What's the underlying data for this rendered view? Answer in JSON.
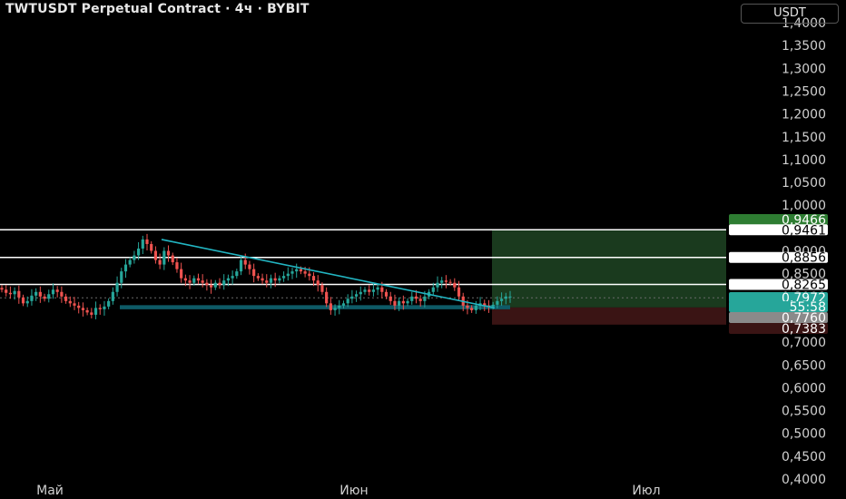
{
  "header": {
    "title": "TWTUSDT Perpetual Contract · 4ч · BYBIT",
    "currency": "USDT"
  },
  "colors": {
    "up": "#26a69a",
    "down": "#ef5350",
    "trendline": "#22b5c2",
    "support_zone": "#0e5a66",
    "profit_zone": "#1a3a1e",
    "stop_zone": "#3a1414",
    "current_price_badge": "#26a69a",
    "white_line": "#ffffff"
  },
  "chart_data": {
    "type": "candlestick",
    "symbol": "TWTUSDT Perpetual Contract",
    "interval": "4ч",
    "exchange": "BYBIT",
    "x_tick_labels": [
      "Май",
      "Июн",
      "Июл"
    ],
    "y_tick_labels": [
      "1,4000",
      "1,3500",
      "1,3000",
      "1,2500",
      "1,2000",
      "1,1500",
      "1,1000",
      "1,0500",
      "1,0000",
      "0,9500",
      "0,9000",
      "0,8500",
      "0,8000",
      "0,7500",
      "0,7000",
      "0,6500",
      "0,6000",
      "0,5500",
      "0,5000",
      "0,4500",
      "0,4000"
    ],
    "ylim": [
      0.4,
      1.4
    ],
    "horizontal_levels": [
      0.9461,
      0.8856,
      0.8265
    ],
    "price_labels": [
      {
        "text": "0,9466",
        "kind": "target"
      },
      {
        "text": "0,9461",
        "kind": "level"
      },
      {
        "text": "0,8856",
        "kind": "level"
      },
      {
        "text": "0,8265",
        "kind": "level"
      },
      {
        "text": "0,7972",
        "kind": "current"
      },
      {
        "text": "55:58",
        "kind": "countdown"
      },
      {
        "text": "0,7760",
        "kind": "entry"
      },
      {
        "text": "0,7383",
        "kind": "stop"
      }
    ],
    "current_price": 0.7972,
    "position": {
      "entry": 0.776,
      "target": 0.9466,
      "stop": 0.7383
    },
    "trendline": {
      "start_price": 0.925,
      "end_price": 0.775
    },
    "support_zone": {
      "low": 0.772,
      "high": 0.781
    },
    "closes": [
      0.815,
      0.808,
      0.805,
      0.812,
      0.798,
      0.785,
      0.79,
      0.802,
      0.81,
      0.8,
      0.795,
      0.805,
      0.815,
      0.81,
      0.8,
      0.79,
      0.785,
      0.78,
      0.775,
      0.77,
      0.765,
      0.76,
      0.775,
      0.772,
      0.778,
      0.79,
      0.81,
      0.83,
      0.855,
      0.87,
      0.88,
      0.89,
      0.905,
      0.925,
      0.915,
      0.9,
      0.88,
      0.87,
      0.9,
      0.89,
      0.875,
      0.86,
      0.84,
      0.835,
      0.83,
      0.84,
      0.835,
      0.83,
      0.825,
      0.82,
      0.83,
      0.825,
      0.835,
      0.84,
      0.845,
      0.855,
      0.88,
      0.87,
      0.86,
      0.845,
      0.84,
      0.835,
      0.83,
      0.84,
      0.835,
      0.84,
      0.845,
      0.85,
      0.855,
      0.86,
      0.855,
      0.85,
      0.845,
      0.835,
      0.825,
      0.81,
      0.785,
      0.77,
      0.775,
      0.78,
      0.785,
      0.795,
      0.8,
      0.805,
      0.81,
      0.815,
      0.81,
      0.815,
      0.82,
      0.81,
      0.8,
      0.79,
      0.78,
      0.79,
      0.785,
      0.79,
      0.8,
      0.795,
      0.79,
      0.8,
      0.81,
      0.82,
      0.83,
      0.835,
      0.832,
      0.83,
      0.82,
      0.8,
      0.78,
      0.775,
      0.77,
      0.78,
      0.785,
      0.78,
      0.778,
      0.782,
      0.79,
      0.795,
      0.8,
      0.8
    ]
  }
}
